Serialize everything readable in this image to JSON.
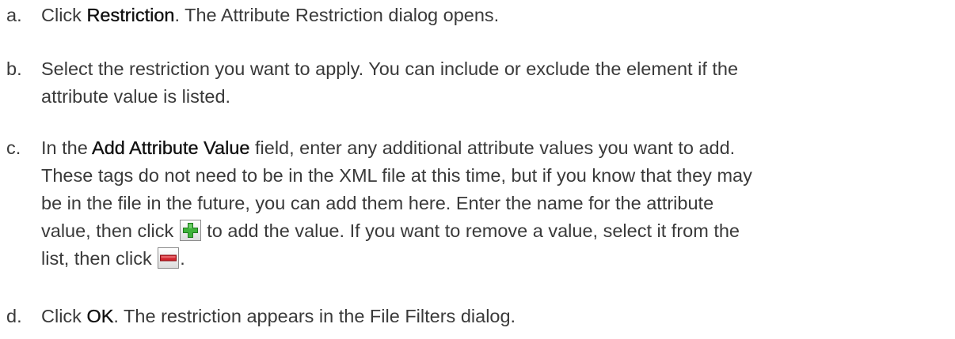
{
  "steps": [
    {
      "marker": "a.",
      "lines": [
        [
          {
            "t": "Click "
          },
          {
            "t": "Restriction",
            "b": true
          },
          {
            "t": ". The Attribute Restriction dialog opens."
          }
        ]
      ]
    },
    {
      "marker": "b.",
      "lines": [
        [
          {
            "t": "Select the restriction you want to apply. You can include or exclude the element if the"
          }
        ],
        [
          {
            "t": "attribute value is listed."
          }
        ]
      ]
    },
    {
      "marker": "c.",
      "lines": [
        [
          {
            "t": "In the "
          },
          {
            "t": "Add Attribute Value",
            "b": true
          },
          {
            "t": " field, enter any additional attribute values you want to add."
          }
        ],
        [
          {
            "t": "These tags do not need to be in the XML file at this time, but if you know that they may"
          }
        ],
        [
          {
            "t": "be in the file in the future, you can add them here. Enter the name for the attribute"
          }
        ],
        [
          {
            "t": "value, then click "
          },
          {
            "icon": "add-icon"
          },
          {
            "t": " to add the value. If you want to remove a value, select it from the"
          }
        ],
        [
          {
            "t": "list, then click "
          },
          {
            "icon": "remove-icon"
          },
          {
            "t": "."
          }
        ]
      ]
    },
    {
      "marker": "d.",
      "lines": [
        [
          {
            "t": "Click "
          },
          {
            "t": "OK",
            "b": true
          },
          {
            "t": ". The restriction appears in the File Filters dialog."
          }
        ]
      ]
    }
  ],
  "colors": {
    "text": "#3a3a3a",
    "ui_term": "#111111",
    "add_icon": "#3fb23a",
    "remove_icon": "#d0222b"
  }
}
